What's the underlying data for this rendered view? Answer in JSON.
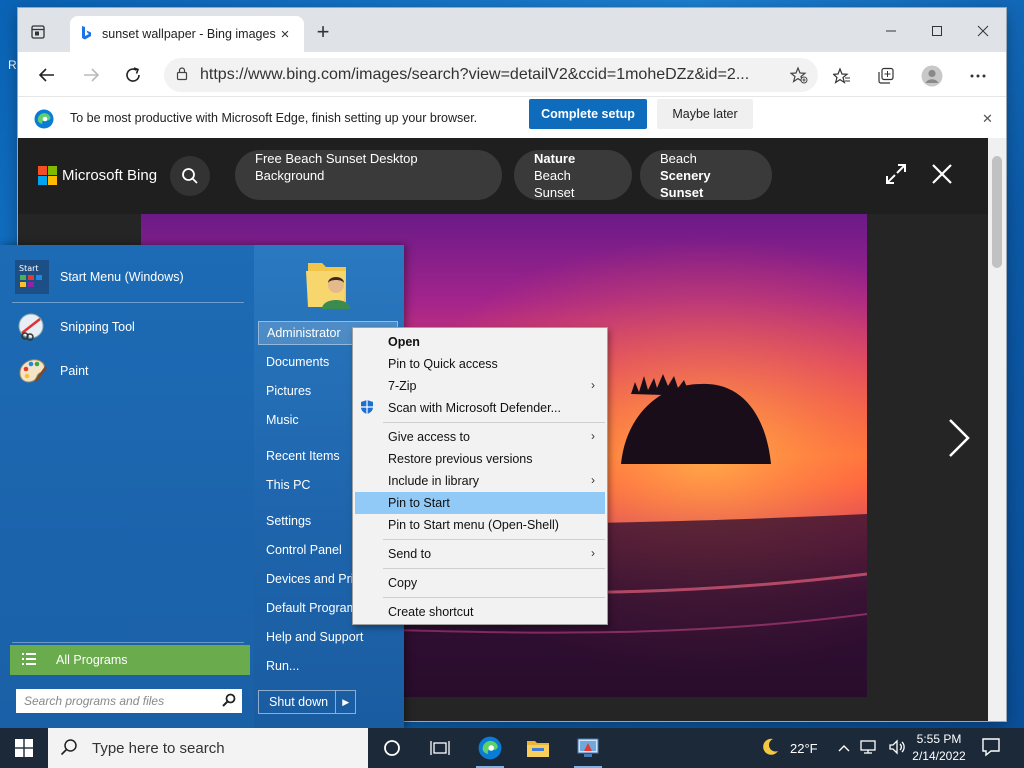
{
  "browser": {
    "tab": {
      "title": "sunset wallpaper - Bing images",
      "close": "×"
    },
    "new_tab": "+",
    "url": "https://www.bing.com/images/search?view=detailV2&ccid=1moheDZz&id=2...",
    "infobar": {
      "text": "To be most productive with Microsoft Edge, finish setting up your browser.",
      "primary_button": "Complete setup",
      "secondary_button": "Maybe later"
    }
  },
  "bing": {
    "logo_text": "Microsoft Bing",
    "chips": [
      {
        "line1": "Free Beach Sunset Desktop Background",
        "line2": ""
      },
      {
        "line1": "Nature",
        "line2": "Beach Sunset"
      },
      {
        "line1": "Beach",
        "line2": "Scenery Sunset"
      }
    ]
  },
  "start_menu": {
    "pinned": [
      {
        "label": "Start Menu (Windows)",
        "icon": "start-menu-icon"
      },
      {
        "label": "Snipping Tool",
        "icon": "snipping-tool-icon"
      },
      {
        "label": "Paint",
        "icon": "paint-icon"
      }
    ],
    "all_programs": "All Programs",
    "search_placeholder": "Search programs and files",
    "right_items": [
      "Administrator",
      "Documents",
      "Pictures",
      "Music",
      "Recent Items",
      "This PC",
      "Settings",
      "Control Panel",
      "Devices and Printers",
      "Default Programs",
      "Help and Support",
      "Run..."
    ],
    "shutdown": "Shut down"
  },
  "context_menu": {
    "items": [
      {
        "label": "Open",
        "bold": true,
        "submenu": false
      },
      {
        "label": "Pin to Quick access",
        "submenu": false
      },
      {
        "label": "7-Zip",
        "submenu": true
      },
      {
        "label": "Scan with Microsoft Defender...",
        "submenu": false,
        "icon": "defender-shield-icon"
      },
      {
        "label": "Give access to",
        "submenu": true
      },
      {
        "label": "Restore previous versions",
        "submenu": false
      },
      {
        "label": "Include in library",
        "submenu": true
      },
      {
        "label": "Pin to Start",
        "submenu": false,
        "highlighted": true
      },
      {
        "label": "Pin to Start menu (Open-Shell)",
        "submenu": false
      },
      {
        "label": "Send to",
        "submenu": true
      },
      {
        "label": "Copy",
        "submenu": false
      },
      {
        "label": "Create shortcut",
        "submenu": false
      }
    ],
    "submenu_arrow": "›"
  },
  "taskbar": {
    "search_placeholder": "Type here to search",
    "weather_temp": "22°F",
    "time": "5:55 PM",
    "date": "2/14/2022"
  },
  "desktop": {
    "edge_label": "R"
  },
  "colors": {
    "accent": "#0f6cbd",
    "all_programs_green": "#6aab4d",
    "menu_highlight": "#91c9f7",
    "taskbar": "#1b2938"
  }
}
